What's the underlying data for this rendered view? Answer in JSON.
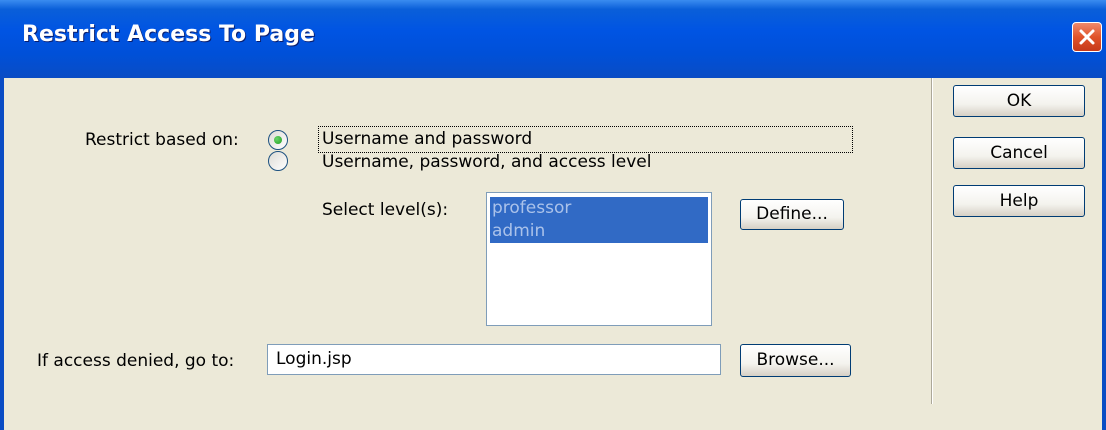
{
  "window": {
    "title": "Restrict Access To Page"
  },
  "restrict": {
    "label": "Restrict based on:",
    "options": [
      {
        "label": "Username and password",
        "selected": true
      },
      {
        "label": "Username, password, and access level",
        "selected": false
      }
    ]
  },
  "levels": {
    "label": "Select level(s):",
    "items": [
      "professor",
      "admin"
    ],
    "define_label": "Define..."
  },
  "denied": {
    "label": "If access denied, go to:",
    "value": "Login.jsp",
    "browse_label": "Browse..."
  },
  "buttons": {
    "ok": "OK",
    "cancel": "Cancel",
    "help": "Help"
  },
  "colors": {
    "titlebar": "#0054e3",
    "selection": "#316ac5",
    "dialog_bg": "#ece9d8"
  },
  "icons": {
    "close": "close-icon",
    "radio_selected": "radio-selected-icon"
  }
}
